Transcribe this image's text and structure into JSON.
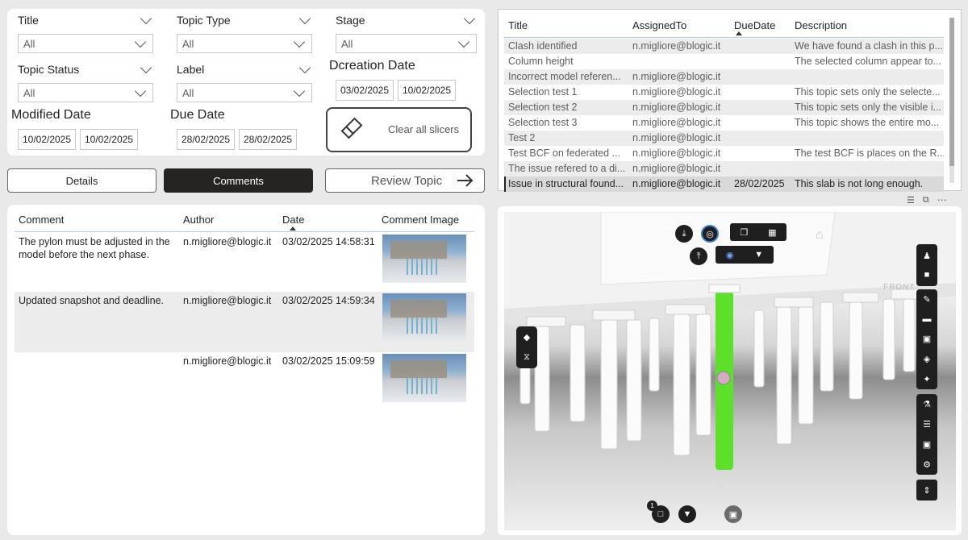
{
  "slicers": {
    "title": {
      "label": "Title",
      "value": "All"
    },
    "topic_type": {
      "label": "Topic Type",
      "value": "All"
    },
    "stage": {
      "label": "Stage",
      "value": "All"
    },
    "topic_status": {
      "label": "Topic Status",
      "value": "All"
    },
    "label": {
      "label": "Label",
      "value": "All"
    },
    "creation_date": {
      "label": "Dcreation Date",
      "from": "03/02/2025",
      "to": "10/02/2025"
    },
    "modified_date": {
      "label": "Modified Date",
      "from": "10/02/2025",
      "to": "10/02/2025"
    },
    "due_date": {
      "label": "Due Date",
      "from": "28/02/2025",
      "to": "28/02/2025"
    },
    "clear_label": "Clear all slicers"
  },
  "nav": {
    "details": "Details",
    "comments": "Comments",
    "review": "Review Topic"
  },
  "topics": {
    "columns": [
      "Title",
      "AssignedTo",
      "DueDate",
      "Description"
    ],
    "rows": [
      [
        "Clash identified",
        "n.migliore@blogic.it",
        "",
        "We have found a clash in this p..."
      ],
      [
        "Column height",
        "",
        "",
        "The selected column appear to..."
      ],
      [
        "Incorrect model referen...",
        "n.migliore@blogic.it",
        "",
        ""
      ],
      [
        "Selection test 1",
        "n.migliore@blogic.it",
        "",
        "This topic sets only the selecte..."
      ],
      [
        "Selection test 2",
        "n.migliore@blogic.it",
        "",
        "This topic sets only the visible i..."
      ],
      [
        "Selection test 3",
        "n.migliore@blogic.it",
        "",
        "This topic shows the entire mo..."
      ],
      [
        "Test 2",
        "n.migliore@blogic.it",
        "",
        ""
      ],
      [
        "Test BCF on federated ...",
        "n.migliore@blogic.it",
        "",
        "The test BCF is places on the R..."
      ],
      [
        "The issue refered to a di...",
        "n.migliore@blogic.it",
        "",
        ""
      ],
      [
        "Issue in structural found...",
        "n.migliore@blogic.it",
        "28/02/2025",
        "This slab is not long enough."
      ]
    ]
  },
  "comments": {
    "columns": [
      "Comment",
      "Author",
      "Date",
      "Comment Image"
    ],
    "rows": [
      {
        "text1": "The pylon must be adjusted in the",
        "text2": "model before the next phase.",
        "author": "n.migliore@blogic.it",
        "date": "03/02/2025 14:58:31"
      },
      {
        "text1": "Updated snapshot and deadline.",
        "text2": "",
        "author": "n.migliore@blogic.it",
        "date": "03/02/2025 14:59:34"
      },
      {
        "text1": "",
        "text2": "",
        "author": "n.migliore@blogic.it",
        "date": "03/02/2025 15:09:59"
      }
    ]
  },
  "viewer": {
    "badge_count": "1",
    "cube_label": "FRONT",
    "highlight_color": "#5ce02a"
  }
}
